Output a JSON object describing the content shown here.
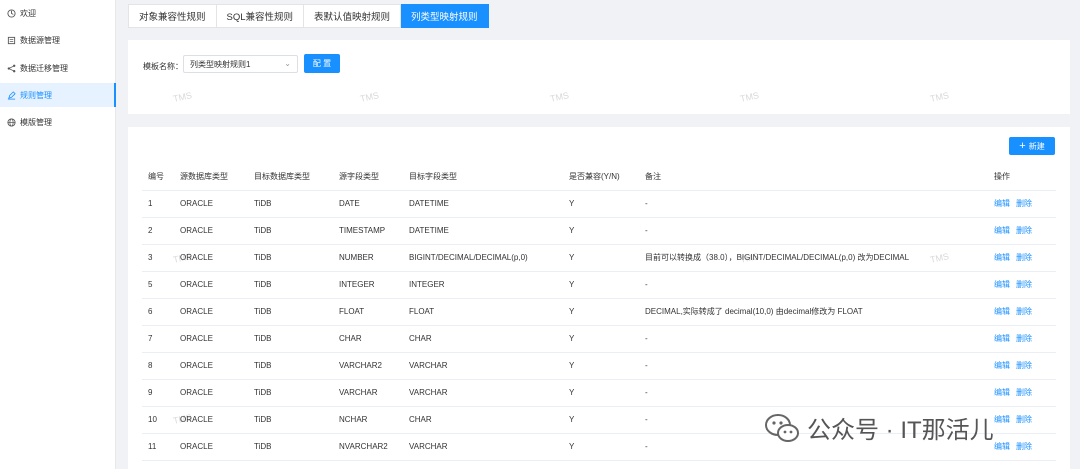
{
  "sidebar": {
    "items": [
      {
        "label": "欢迎",
        "icon": "home-icon"
      },
      {
        "label": "数据源管理",
        "icon": "database-icon"
      },
      {
        "label": "数据迁移管理",
        "icon": "migrate-icon"
      },
      {
        "label": "规则管理",
        "icon": "rule-icon",
        "active": true
      },
      {
        "label": "模版管理",
        "icon": "template-icon"
      }
    ]
  },
  "tabs": [
    "对象兼容性规则",
    "SQL兼容性规则",
    "表默认值映射规则",
    "列类型映射规则"
  ],
  "template": {
    "label": "模板名称：",
    "selected": "列类型映射规则1",
    "config_button": "配 置"
  },
  "new_button": "新建",
  "watermark": "TMS",
  "table": {
    "headers": [
      "编号",
      "源数据库类型",
      "目标数据库类型",
      "源字段类型",
      "目标字段类型",
      "是否兼容(Y/N)",
      "备注",
      "操作"
    ],
    "actions": {
      "edit": "编辑",
      "delete": "删除"
    },
    "rows": [
      [
        "1",
        "ORACLE",
        "TiDB",
        "DATE",
        "DATETIME",
        "Y",
        "-"
      ],
      [
        "2",
        "ORACLE",
        "TiDB",
        "TIMESTAMP",
        "DATETIME",
        "Y",
        "-"
      ],
      [
        "3",
        "ORACLE",
        "TiDB",
        "NUMBER",
        "BIGINT/DECIMAL/DECIMAL(p,0)",
        "Y",
        "目前可以转换成（38.0），BIGINT/DECIMAL/DECIMAL(p,0) 改为DECIMAL"
      ],
      [
        "5",
        "ORACLE",
        "TiDB",
        "INTEGER",
        "INTEGER",
        "Y",
        "-"
      ],
      [
        "6",
        "ORACLE",
        "TiDB",
        "FLOAT",
        "FLOAT",
        "Y",
        "DECIMAL,实际转成了 decimal(10,0) 由decimal修改为 FLOAT"
      ],
      [
        "7",
        "ORACLE",
        "TiDB",
        "CHAR",
        "CHAR",
        "Y",
        "-"
      ],
      [
        "8",
        "ORACLE",
        "TiDB",
        "VARCHAR2",
        "VARCHAR",
        "Y",
        "-"
      ],
      [
        "9",
        "ORACLE",
        "TiDB",
        "VARCHAR",
        "VARCHAR",
        "Y",
        "-"
      ],
      [
        "10",
        "ORACLE",
        "TiDB",
        "NCHAR",
        "CHAR",
        "Y",
        "-"
      ],
      [
        "11",
        "ORACLE",
        "TiDB",
        "NVARCHAR2",
        "VARCHAR",
        "Y",
        "-"
      ]
    ]
  },
  "wechat_text": "公众号 · IT那活儿"
}
